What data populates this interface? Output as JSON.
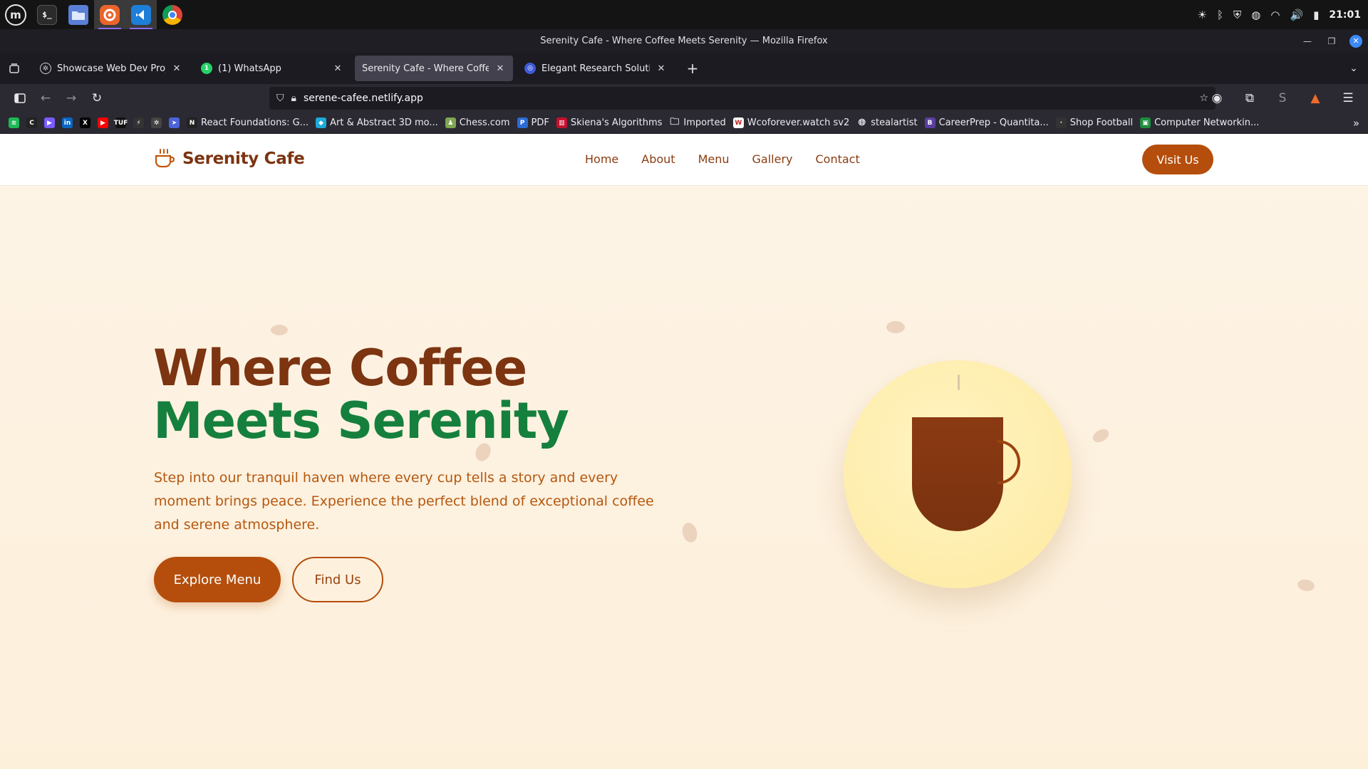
{
  "system_panel": {
    "launchers": [
      {
        "name": "mint-menu",
        "icon": "mint-logo-icon"
      },
      {
        "name": "terminal",
        "icon": "terminal-icon",
        "glyph": "$_"
      },
      {
        "name": "files",
        "icon": "folder-icon"
      },
      {
        "name": "firefox",
        "icon": "firefox-icon"
      },
      {
        "name": "vscode",
        "icon": "vscode-icon"
      },
      {
        "name": "chrome",
        "icon": "chrome-icon"
      }
    ],
    "clock": "21:01"
  },
  "window": {
    "title": "Serenity Cafe - Where Coffee Meets Serenity — Mozilla Firefox"
  },
  "tabs": [
    {
      "title": "Showcase Web Dev Projects",
      "favicon": "chatgpt-icon",
      "active": false
    },
    {
      "title": "(1) WhatsApp",
      "favicon": "whatsapp-icon",
      "active": false
    },
    {
      "title": "Serenity Cafe - Where Coffee Meets Serenity",
      "favicon": "cafe-icon",
      "active": true
    },
    {
      "title": "Elegant Research Solution",
      "favicon": "elegant-icon",
      "active": false
    }
  ],
  "urlbar": {
    "url": "serene-cafee.netlify.app"
  },
  "bookmarks": [
    {
      "label": "",
      "icon": "spotify-icon",
      "color": "#1db954"
    },
    {
      "label": "",
      "icon": "c-icon",
      "color": "#222222"
    },
    {
      "label": "",
      "icon": "app-icon",
      "color": "#7b5cff"
    },
    {
      "label": "",
      "icon": "linkedin-icon",
      "color": "#0a66c2"
    },
    {
      "label": "",
      "icon": "x-icon",
      "color": "#000000"
    },
    {
      "label": "",
      "icon": "youtube-icon",
      "color": "#ff0000"
    },
    {
      "label": "",
      "icon": "tuf-icon",
      "color": "#111111"
    },
    {
      "label": "",
      "icon": "bolt-icon",
      "color": "#333333"
    },
    {
      "label": "",
      "icon": "openai-icon",
      "color": "#444444"
    },
    {
      "label": "",
      "icon": "nav-icon",
      "color": "#4c63d9"
    },
    {
      "label": "React Foundations: G...",
      "icon": "notion-icon",
      "color": "#222222"
    },
    {
      "label": "Art & Abstract 3D mo...",
      "icon": "sketchfab-icon",
      "color": "#1caad9"
    },
    {
      "label": "Chess.com",
      "icon": "pawn-icon",
      "color": "#7fa650"
    },
    {
      "label": "PDF",
      "icon": "pdf-icon",
      "color": "#2b6cd6"
    },
    {
      "label": "Skiena's Algorithms",
      "icon": "book-icon",
      "color": "#c8102e"
    },
    {
      "label": "Imported",
      "icon": "folder-icon",
      "color": ""
    },
    {
      "label": "Wcoforever.watch sv2",
      "icon": "wco-icon",
      "color": "#ffffff"
    },
    {
      "label": "stealartist",
      "icon": "globe-icon",
      "color": ""
    },
    {
      "label": "CareerPrep - Quantita...",
      "icon": "b-icon",
      "color": "#5b3fa0"
    },
    {
      "label": "Shop Football",
      "icon": "shop-icon",
      "color": "#333333"
    },
    {
      "label": "Computer Networkin...",
      "icon": "classroom-icon",
      "color": "#1e8e3e"
    }
  ],
  "site": {
    "brand": "Serenity Cafe",
    "nav": [
      "Home",
      "About",
      "Menu",
      "Gallery",
      "Contact"
    ],
    "cta": "Visit Us",
    "hero": {
      "title_line1": "Where Coffee",
      "title_line2": "Meets Serenity",
      "description": "Step into our tranquil haven where every cup tells a story and every moment brings peace. Experience the perfect blend of exceptional coffee and serene atmosphere.",
      "primary_button": "Explore Menu",
      "secondary_button": "Find Us"
    },
    "colors": {
      "brown": "#7c3411",
      "green": "#15803d",
      "accent": "#b54e0c",
      "text": "#b5580f",
      "circle": "#fee9a0"
    }
  }
}
